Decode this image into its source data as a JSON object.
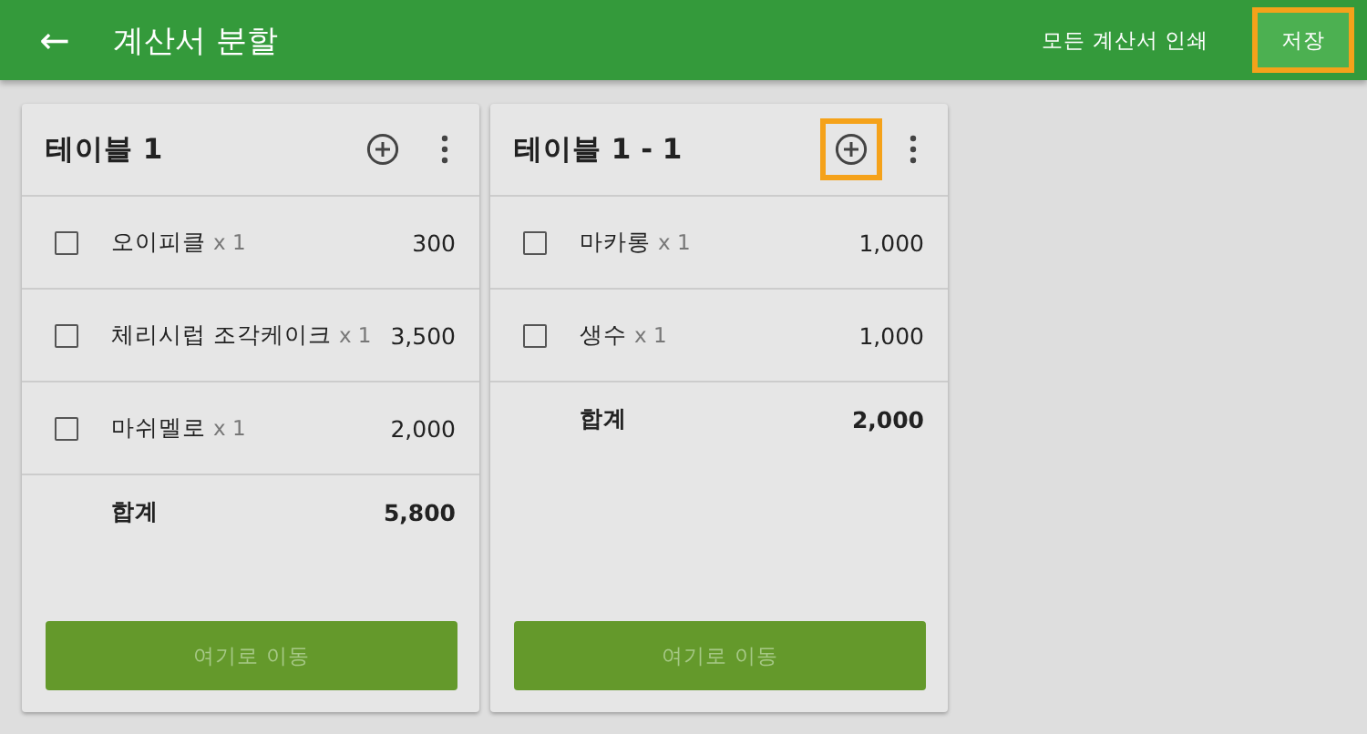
{
  "app_bar": {
    "back_icon": "←",
    "title": "계산서 분할",
    "actions": [
      {
        "label": "모든 계산서 인쇄",
        "kind": "text",
        "highlighted": false
      },
      {
        "label": "저장",
        "kind": "filled",
        "highlighted": true
      }
    ]
  },
  "bills": [
    {
      "title": "테이블 1",
      "add_highlighted": false,
      "items": [
        {
          "name": "오이피클",
          "qty": "x 1",
          "price": "300",
          "checked": false
        },
        {
          "name": "체리시럽 조각케이크",
          "qty": "x 1",
          "price": "3,500",
          "checked": false
        },
        {
          "name": "마쉬멜로",
          "qty": "x 1",
          "price": "2,000",
          "checked": false
        }
      ],
      "total_label": "합계",
      "total": "5,800",
      "move_button": {
        "label": "여기로 이동",
        "disabled": true
      }
    },
    {
      "title": "테이블 1 - 1",
      "add_highlighted": true,
      "items": [
        {
          "name": "마카롱",
          "qty": "x 1",
          "price": "1,000",
          "checked": false
        },
        {
          "name": "생수",
          "qty": "x 1",
          "price": "1,000",
          "checked": false
        }
      ],
      "total_label": "합계",
      "total": "2,000",
      "move_button": {
        "label": "여기로 이동",
        "disabled": true
      }
    }
  ]
}
